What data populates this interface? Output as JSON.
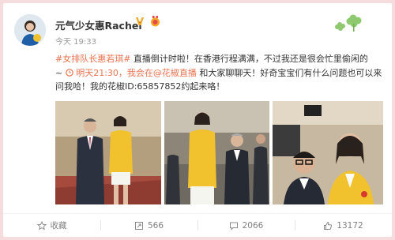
{
  "post": {
    "author": "元气少女惠Rachel",
    "verified_mark": "V",
    "time": "今天 19:33",
    "text": {
      "hashtag": "#女排队长惠若琪#",
      "line1_rest": " 直播倒计时啦！在香港行程满满，不过我还是很会忙里偷闲的",
      "prefix": "~",
      "clock_link": "明天21:30，我会在@花椒直播",
      "rest": " 和大家聊聊天！好奇宝宝们有什么问题也可以来问我哈！我的花椒ID:65857852约起来咯！"
    }
  },
  "actions": {
    "favorite": "收藏",
    "repost": "566",
    "comment": "2066",
    "like": "13172"
  },
  "colors": {
    "background": "#f6dcdc",
    "link": "#eb7350",
    "jacket": "#f2c12e"
  }
}
